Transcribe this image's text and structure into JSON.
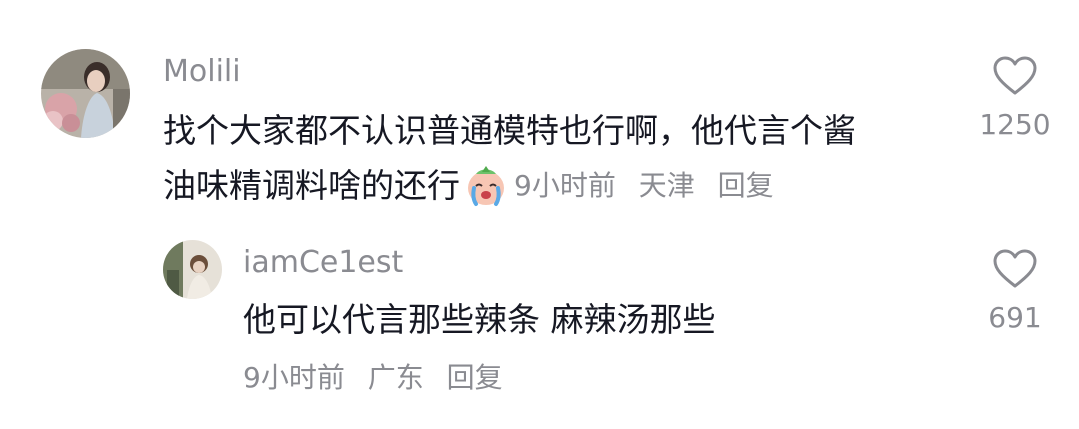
{
  "comments": [
    {
      "username": "Molili",
      "text_line1": "找个大家都不认识普通模特也行啊，他代言个酱",
      "text_line2": "油味精调料啥的还行",
      "emoji": "crying-face-emoji",
      "time": "9小时前",
      "location": "天津",
      "reply_label": "回复",
      "likes": "1250",
      "avatar": "avatar-woman-with-flowers"
    },
    {
      "username": "iamCe1est",
      "text": "他可以代言那些辣条 麻辣汤那些",
      "time": "9小时前",
      "location": "广东",
      "reply_label": "回复",
      "likes": "691",
      "avatar": "avatar-person-outdoor"
    }
  ],
  "icons": {
    "like": "heart-outline-icon"
  },
  "colors": {
    "primary_text": "#161823",
    "secondary_text": "#8a8b91",
    "background": "#ffffff"
  }
}
